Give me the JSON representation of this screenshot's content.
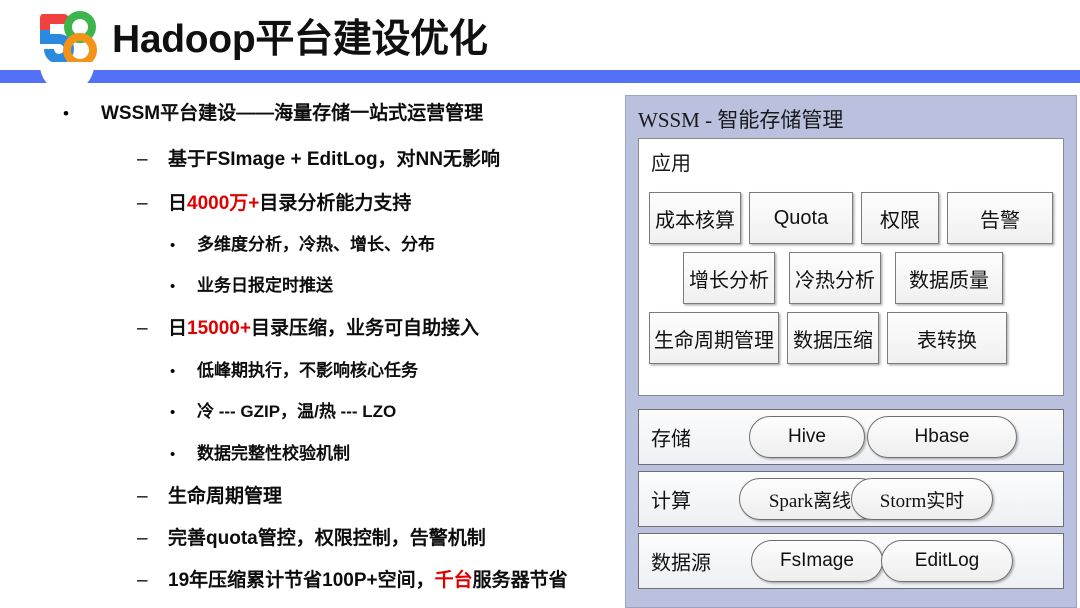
{
  "header": {
    "title": "Hadoop平台建设优化",
    "logo": {
      "name": "58-logo",
      "digit_left": "5",
      "digit_right": "8",
      "colors": {
        "red": "#f04040",
        "blue": "#2b8ae0",
        "green": "#3cb54a",
        "orange": "#f39318"
      }
    },
    "bar_color": "#5271f5"
  },
  "colors": {
    "accent_red": "#e00000",
    "panel_bg": "#b9c1de",
    "bar_blue": "#5271f5"
  },
  "bullets": [
    {
      "level": 1,
      "marker": "•",
      "parts": [
        {
          "text": "WSSM平台建设——海量存储一站式运营管理",
          "red": false
        }
      ]
    },
    {
      "level": 2,
      "marker": "–",
      "parts": [
        {
          "text": "基于FSImage + EditLog，对NN无影响",
          "red": false
        }
      ]
    },
    {
      "level": 2,
      "marker": "–",
      "parts": [
        {
          "text": "日",
          "red": false
        },
        {
          "text": "4000万+",
          "red": true
        },
        {
          "text": "目录分析能力支持",
          "red": false
        }
      ]
    },
    {
      "level": 3,
      "marker": "•",
      "parts": [
        {
          "text": "多维度分析，冷热、增长、分布",
          "red": false
        }
      ]
    },
    {
      "level": 3,
      "marker": "•",
      "parts": [
        {
          "text": "业务日报定时推送",
          "red": false
        }
      ]
    },
    {
      "level": 2,
      "marker": "–",
      "parts": [
        {
          "text": "日",
          "red": false
        },
        {
          "text": "15000+",
          "red": true
        },
        {
          "text": "目录压缩，业务可自助接入",
          "red": false
        }
      ]
    },
    {
      "level": 3,
      "marker": "•",
      "parts": [
        {
          "text": "低峰期执行，不影响核心任务",
          "red": false
        }
      ]
    },
    {
      "level": 3,
      "marker": "•",
      "parts": [
        {
          "text": "冷 --- GZIP，温/热 --- LZO",
          "red": false
        }
      ]
    },
    {
      "level": 3,
      "marker": "•",
      "parts": [
        {
          "text": "数据完整性校验机制",
          "red": false
        }
      ]
    },
    {
      "level": 2,
      "marker": "–",
      "parts": [
        {
          "text": "生命周期管理",
          "red": false
        }
      ]
    },
    {
      "level": 2,
      "marker": "–",
      "parts": [
        {
          "text": "完善quota管控，权限控制，告警机制",
          "red": false
        }
      ]
    },
    {
      "level": 2,
      "marker": "–",
      "parts": [
        {
          "text": "19年压缩累计节省100P+空间，",
          "red": false
        },
        {
          "text": "千台",
          "red": true
        },
        {
          "text": "服务器节省",
          "red": false
        }
      ]
    }
  ],
  "diagram": {
    "title": "WSSM - 智能存储管理",
    "app_section": {
      "label": "应用",
      "rows": [
        [
          {
            "label": "成本核算",
            "latin": false
          },
          {
            "label": "Quota",
            "latin": true
          },
          {
            "label": "权限",
            "latin": false
          },
          {
            "label": "告警",
            "latin": false
          }
        ],
        [
          {
            "label": "增长分析",
            "latin": false
          },
          {
            "label": "冷热分析",
            "latin": false
          },
          {
            "label": "数据质量",
            "latin": false
          }
        ],
        [
          {
            "label": "生命周期管理",
            "latin": false
          },
          {
            "label": "数据压缩",
            "latin": false
          },
          {
            "label": "表转换",
            "latin": false
          }
        ]
      ]
    },
    "tiers": [
      {
        "label": "存储",
        "pills": [
          {
            "label": "Hive",
            "cjk": false
          },
          {
            "label": "Hbase",
            "cjk": false
          }
        ]
      },
      {
        "label": "计算",
        "pills": [
          {
            "label": "Spark离线",
            "cjk": true
          },
          {
            "label": "Storm实时",
            "cjk": true
          }
        ]
      },
      {
        "label": "数据源",
        "pills": [
          {
            "label": "FsImage",
            "cjk": false
          },
          {
            "label": "EditLog",
            "cjk": false
          }
        ]
      }
    ]
  }
}
